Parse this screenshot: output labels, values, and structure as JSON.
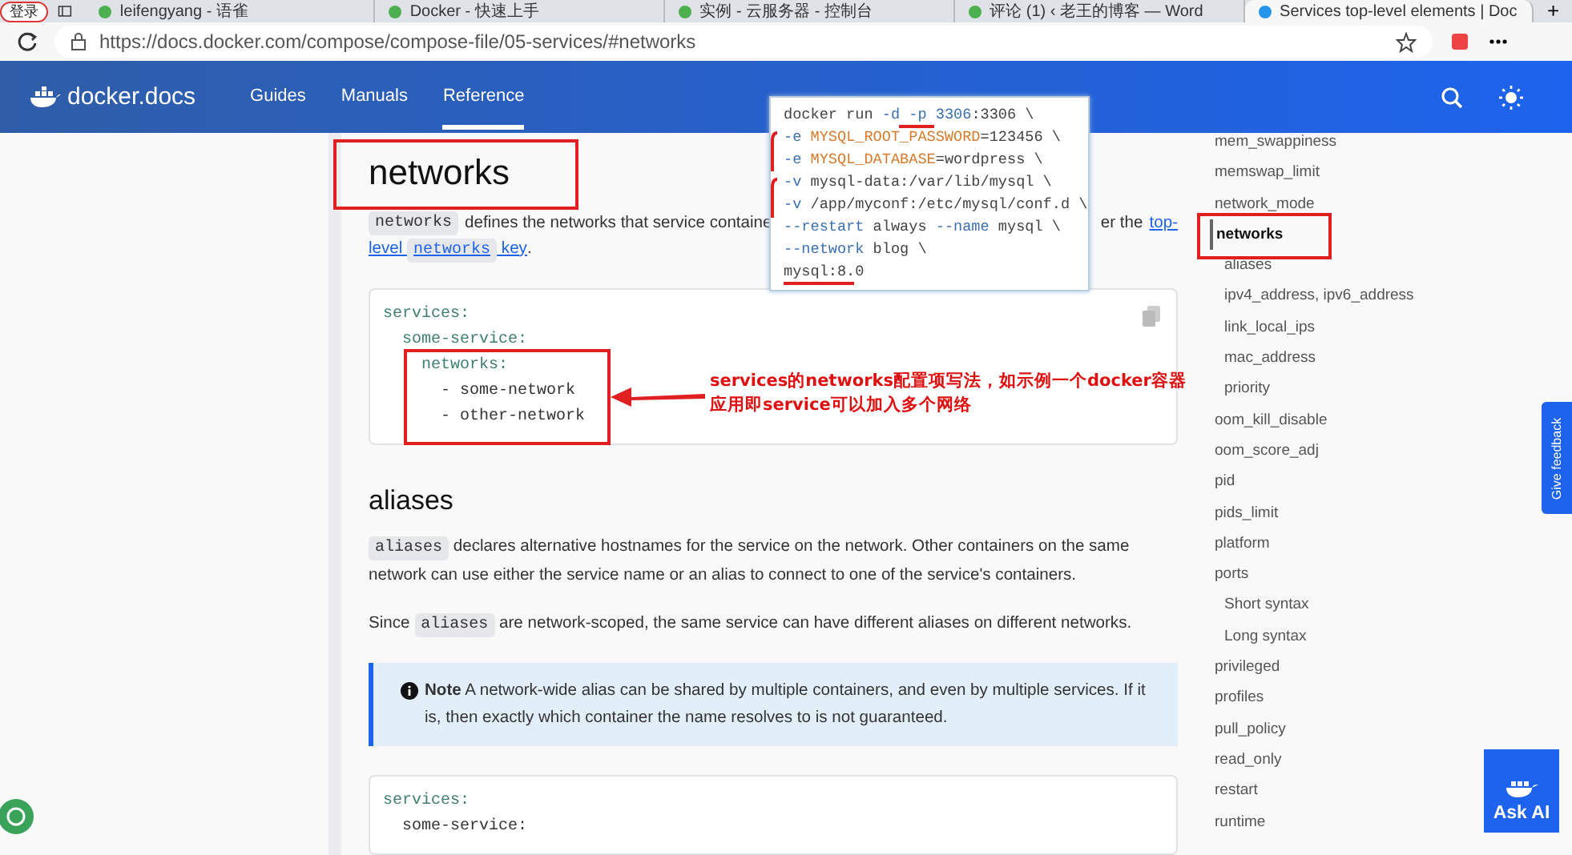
{
  "browser": {
    "login_button": "登录",
    "tabs": [
      {
        "title": "leifengyang - 语雀",
        "selected": false
      },
      {
        "title": "Docker - 快速上手",
        "selected": false
      },
      {
        "title": "实例 - 云服务器 - 控制台",
        "selected": false
      },
      {
        "title": "评论 (1) ‹ 老王的博客 — Word",
        "selected": false
      },
      {
        "title": "Services top-level elements | Doc",
        "selected": true
      }
    ],
    "new_tab": "+",
    "address": "https://docs.docker.com/compose/compose-file/05-services/#networks"
  },
  "nav": {
    "logo": "docker.docs",
    "links": [
      {
        "label": "Guides",
        "selected": false
      },
      {
        "label": "Manuals",
        "selected": false
      },
      {
        "label": "Reference",
        "selected": true
      }
    ]
  },
  "content": {
    "heading": "networks",
    "intro": {
      "code": "networks",
      "text": "defines the networks that service containe",
      "text_after": "er the",
      "link_1": "top-",
      "link_2": "level",
      "link_code": "networks",
      "link_3": "key",
      "end": "."
    },
    "code_block": {
      "lines": [
        {
          "text": "services:",
          "children": [
            {
              "text": "some-service:",
              "children": [
                {
                  "text": "networks:",
                  "children": [
                    {
                      "text": "- some-network"
                    },
                    {
                      "text": "- other-network"
                    }
                  ]
                }
              ]
            }
          ]
        }
      ]
    },
    "section_heading": "aliases",
    "paragraphs": [
      [
        {
          "kind": "code",
          "text": "aliases"
        },
        {
          "kind": "text",
          "text": "declares alternative hostnames for the service on the network. Other containers on the same network can use either the service name or an alias to connect to one of the service's containers."
        }
      ],
      [
        {
          "kind": "text",
          "text": "Since"
        },
        {
          "kind": "code",
          "text": "aliases"
        },
        {
          "kind": "text",
          "text": "are network-scoped, the same service can have different aliases on different networks."
        }
      ]
    ],
    "note": {
      "label": "Note",
      "text": "A network-wide alias can be shared by multiple containers, and even by multiple services. If it is, then exactly which container the name resolves to is not guaranteed."
    },
    "code_block_2": {
      "lines": [
        {
          "text": "services:",
          "children": [
            {
              "text": "some-service:"
            }
          ]
        }
      ]
    }
  },
  "toc": [
    {
      "label": "mem_swappiness",
      "selected": false
    },
    {
      "label": "memswap_limit",
      "selected": false
    },
    {
      "label": "network_mode",
      "selected": false
    },
    {
      "label": "networks",
      "selected": true,
      "children": [
        {
          "label": "aliases",
          "selected": false
        },
        {
          "label": "ipv4_address, ipv6_address",
          "selected": false
        },
        {
          "label": "link_local_ips",
          "selected": false
        },
        {
          "label": "mac_address",
          "selected": false
        },
        {
          "label": "priority",
          "selected": false
        }
      ]
    },
    {
      "label": "oom_kill_disable",
      "selected": false
    },
    {
      "label": "oom_score_adj",
      "selected": false
    },
    {
      "label": "pid",
      "selected": false
    },
    {
      "label": "pids_limit",
      "selected": false
    },
    {
      "label": "platform",
      "selected": false
    },
    {
      "label": "ports",
      "selected": false,
      "children": [
        {
          "label": "Short syntax",
          "selected": false
        },
        {
          "label": "Long syntax",
          "selected": false
        }
      ]
    },
    {
      "label": "privileged",
      "selected": false
    },
    {
      "label": "profiles",
      "selected": false
    },
    {
      "label": "pull_policy",
      "selected": false
    },
    {
      "label": "read_only",
      "selected": false
    },
    {
      "label": "restart",
      "selected": false
    },
    {
      "label": "runtime",
      "selected": false
    }
  ],
  "feedback_tab": "Give feedback",
  "ask_ai": "Ask AI",
  "annotation": {
    "text": "services的networks配置项写法，如示例一个docker容器应用即service可以加入多个网络",
    "popup_lines": [
      [
        {
          "kind": "plain",
          "text": "docker run "
        },
        {
          "kind": "flag",
          "text": "-d -p"
        },
        {
          "kind": "num",
          "text": " 3306"
        },
        {
          "kind": "plain",
          "text": ":3306 \\"
        }
      ],
      [
        {
          "kind": "flag",
          "text": "-e"
        },
        {
          "kind": "env",
          "text": " MYSQL_ROOT_PASSWORD"
        },
        {
          "kind": "plain",
          "text": "=123456 \\"
        }
      ],
      [
        {
          "kind": "flag",
          "text": "-e"
        },
        {
          "kind": "env",
          "text": " MYSQL_DATABASE"
        },
        {
          "kind": "plain",
          "text": "=wordpress \\"
        }
      ],
      [
        {
          "kind": "flag",
          "text": "-v"
        },
        {
          "kind": "plain",
          "text": " mysql-data:/var/lib/mysql \\"
        }
      ],
      [
        {
          "kind": "flag",
          "text": "-v"
        },
        {
          "kind": "plain",
          "text": " /app/myconf:/etc/mysql/conf.d \\"
        }
      ],
      [
        {
          "kind": "flag",
          "text": "--restart"
        },
        {
          "kind": "plain",
          "text": " always "
        },
        {
          "kind": "flag",
          "text": "--name"
        },
        {
          "kind": "plain",
          "text": " mysql \\"
        }
      ],
      [
        {
          "kind": "flag",
          "text": "--network"
        },
        {
          "kind": "plain",
          "text": " blog \\"
        }
      ],
      [
        {
          "kind": "plain",
          "text": "mysql:8.0"
        }
      ]
    ]
  }
}
